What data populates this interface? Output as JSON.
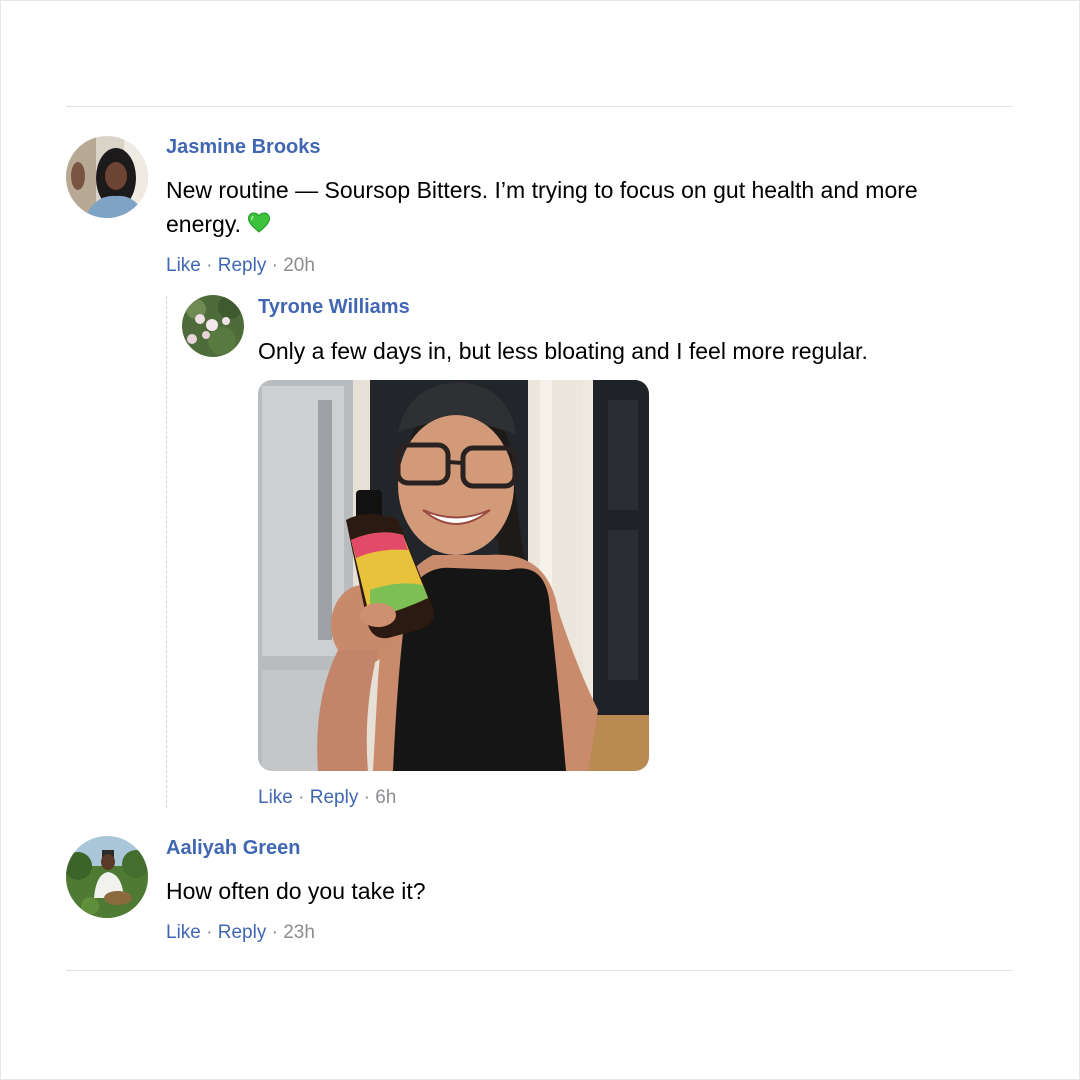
{
  "comments": [
    {
      "author": "Jasmine Brooks",
      "text_line1": "New routine — Soursop Bitters. I’m trying to focus on gut health and more",
      "text_line2": "energy.",
      "emoji": "💚",
      "like": "Like",
      "reply": "Reply",
      "time": "20h",
      "avatar": "avatar-photo-woman-dark-hair"
    },
    {
      "author": "Tyrone Williams",
      "text": "Only a few days in, but less bloating and I feel more regular.",
      "like": "Like",
      "reply": "Reply",
      "time": "6h",
      "avatar": "avatar-photo-roses",
      "attachment": "photo-woman-holding-bitters-bottle"
    },
    {
      "author": "Aaliyah Green",
      "text": "How often do you take it?",
      "like": "Like",
      "reply": "Reply",
      "time": "23h",
      "avatar": "avatar-photo-garden"
    }
  ],
  "separator": "·",
  "colors": {
    "link": "#4267b2",
    "muted": "#8a8d91",
    "divider": "#dfe1e5"
  }
}
